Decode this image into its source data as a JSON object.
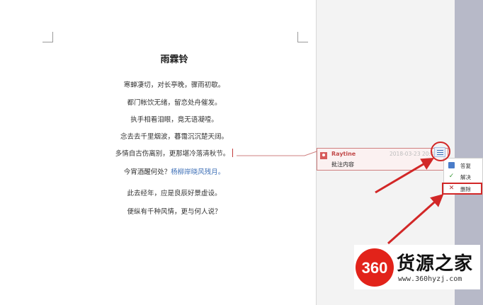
{
  "document": {
    "title": "雨霖铃",
    "lines": [
      "寒蝉凄切，对长亭晚，骤雨初歇。",
      "都门帐饮无绪，留恋处舟催发。",
      "执手相看泪眼，竟无语凝噎。",
      "念去去千里烟波，暮霭沉沉楚天阔。",
      "多情自古伤离别，更那堪冷落清秋节。",
      "今宵酒醒何处？",
      "此去经年，应是良辰好景虚设。",
      "便纵有千种风情，更与何人说？"
    ],
    "highlighted_text": "杨柳岸晓风残月。"
  },
  "comment": {
    "author": "Raytine",
    "timestamp": "2018-03-23 20:4",
    "body": "批注内容"
  },
  "context_menu": {
    "reply": "答复",
    "resolve": "解决",
    "delete": "删除"
  },
  "watermark": {
    "number": "360",
    "brand": "货源之家",
    "url": "www.360hyzj.com"
  },
  "colors": {
    "annotation_red": "#d22727",
    "comment_author": "#c24a4a",
    "highlight_blue": "#3d6fb6"
  }
}
